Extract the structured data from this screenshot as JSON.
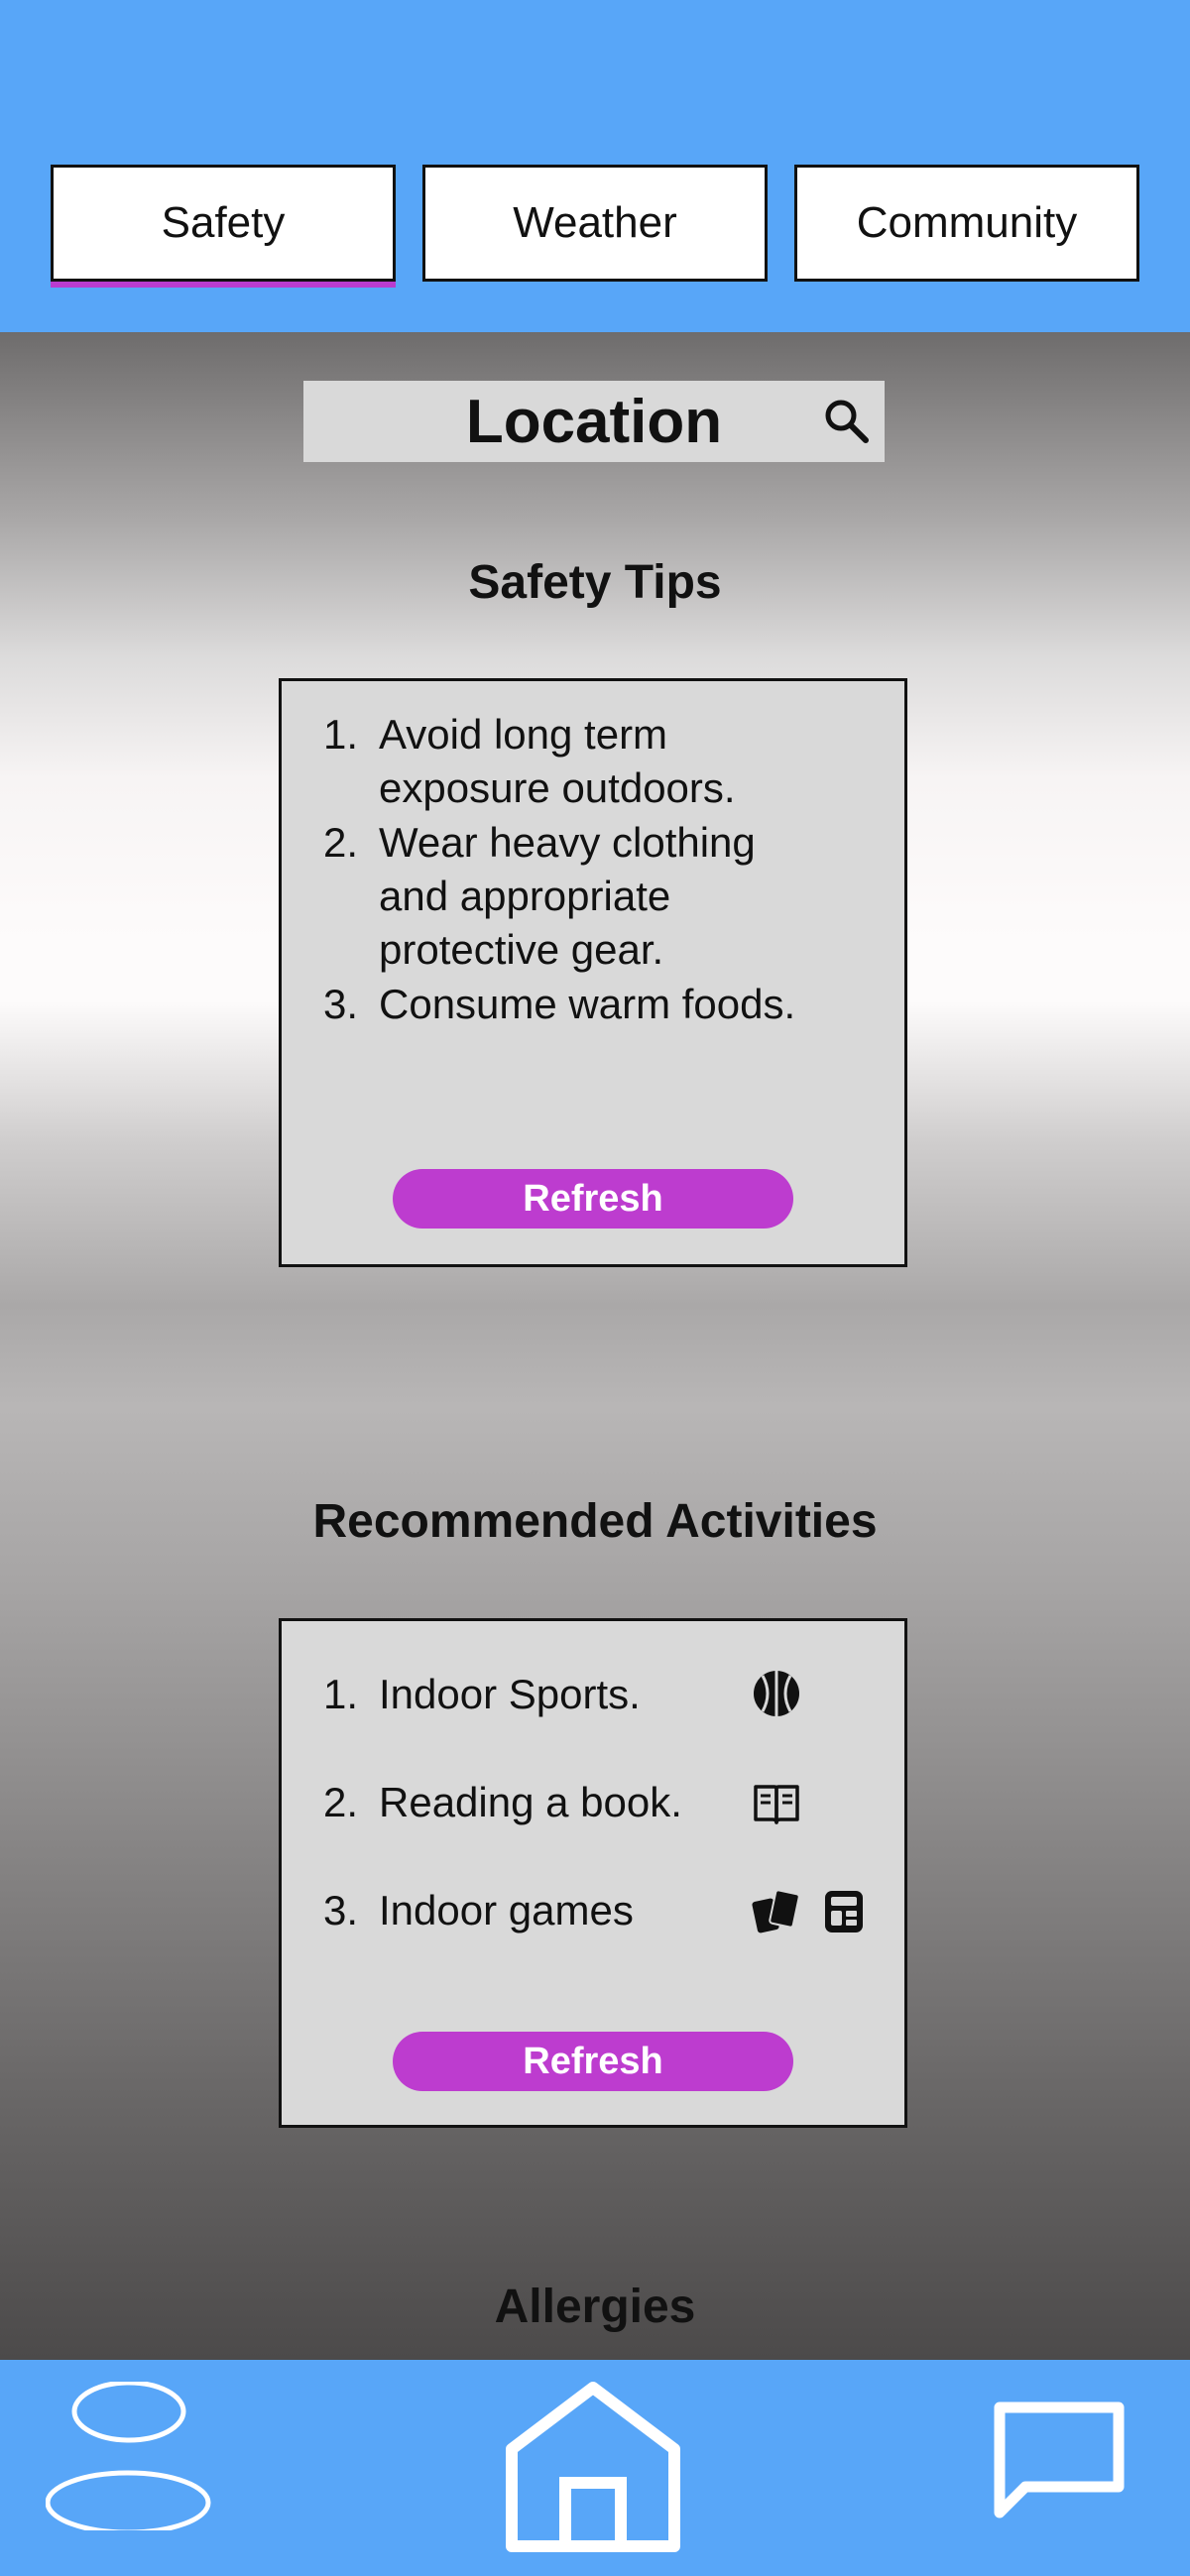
{
  "tabs": [
    {
      "label": "Safety",
      "active": true
    },
    {
      "label": "Weather",
      "active": false
    },
    {
      "label": "Community",
      "active": false
    }
  ],
  "location": {
    "label": "Location",
    "icon": "search-icon"
  },
  "safety_tips": {
    "title": "Safety Tips",
    "items": [
      {
        "num": "1.",
        "text": "Avoid long term\nexposure outdoors."
      },
      {
        "num": "2.",
        "text": "Wear heavy clothing\nand appropriate\nprotective gear."
      },
      {
        "num": "3.",
        "text": "Consume warm foods."
      }
    ],
    "refresh_label": "Refresh"
  },
  "activities": {
    "title": "Recommended Activities",
    "items": [
      {
        "num": "1.",
        "text": "Indoor Sports.",
        "icons": [
          "basketball-icon"
        ]
      },
      {
        "num": "2.",
        "text": "Reading a book.",
        "icons": [
          "book-icon"
        ]
      },
      {
        "num": "3.",
        "text": "Indoor games",
        "icons": [
          "cards-icon",
          "calculator-icon"
        ]
      }
    ],
    "refresh_label": "Refresh"
  },
  "allergies": {
    "title": "Allergies"
  },
  "bottom_nav": [
    {
      "icon": "profile-icon"
    },
    {
      "icon": "home-icon"
    },
    {
      "icon": "chat-icon"
    }
  ],
  "colors": {
    "bar_blue": "#58a6f8",
    "accent_purple": "#bd3ccf",
    "card_gray": "#d9d9d9"
  }
}
